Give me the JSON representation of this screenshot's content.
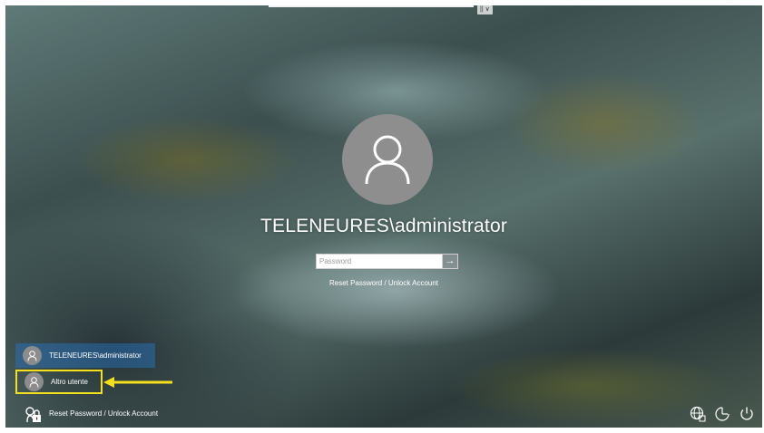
{
  "top_bar": {
    "keyboard_indicator": "|| ∨"
  },
  "login": {
    "username": "TELENEURES\\administrator",
    "password_placeholder": "Password",
    "submit_icon": "arrow-right-icon",
    "reset_link": "Reset Password / Unlock Account"
  },
  "user_list": {
    "items": [
      {
        "label": "TELENEURES\\administrator",
        "icon": "user-icon",
        "selected": true
      },
      {
        "label": "Altro utente",
        "icon": "user-icon",
        "highlighted": true
      },
      {
        "label": "Reset Password / Unlock Account",
        "icon": "lock-icon"
      }
    ]
  },
  "bottom_icons": [
    "globe-icon",
    "accessibility-icon",
    "power-icon"
  ],
  "colors": {
    "highlight_box": "#f5e01e",
    "arrow": "#f5e01e",
    "selected_item": "#2878c8"
  }
}
